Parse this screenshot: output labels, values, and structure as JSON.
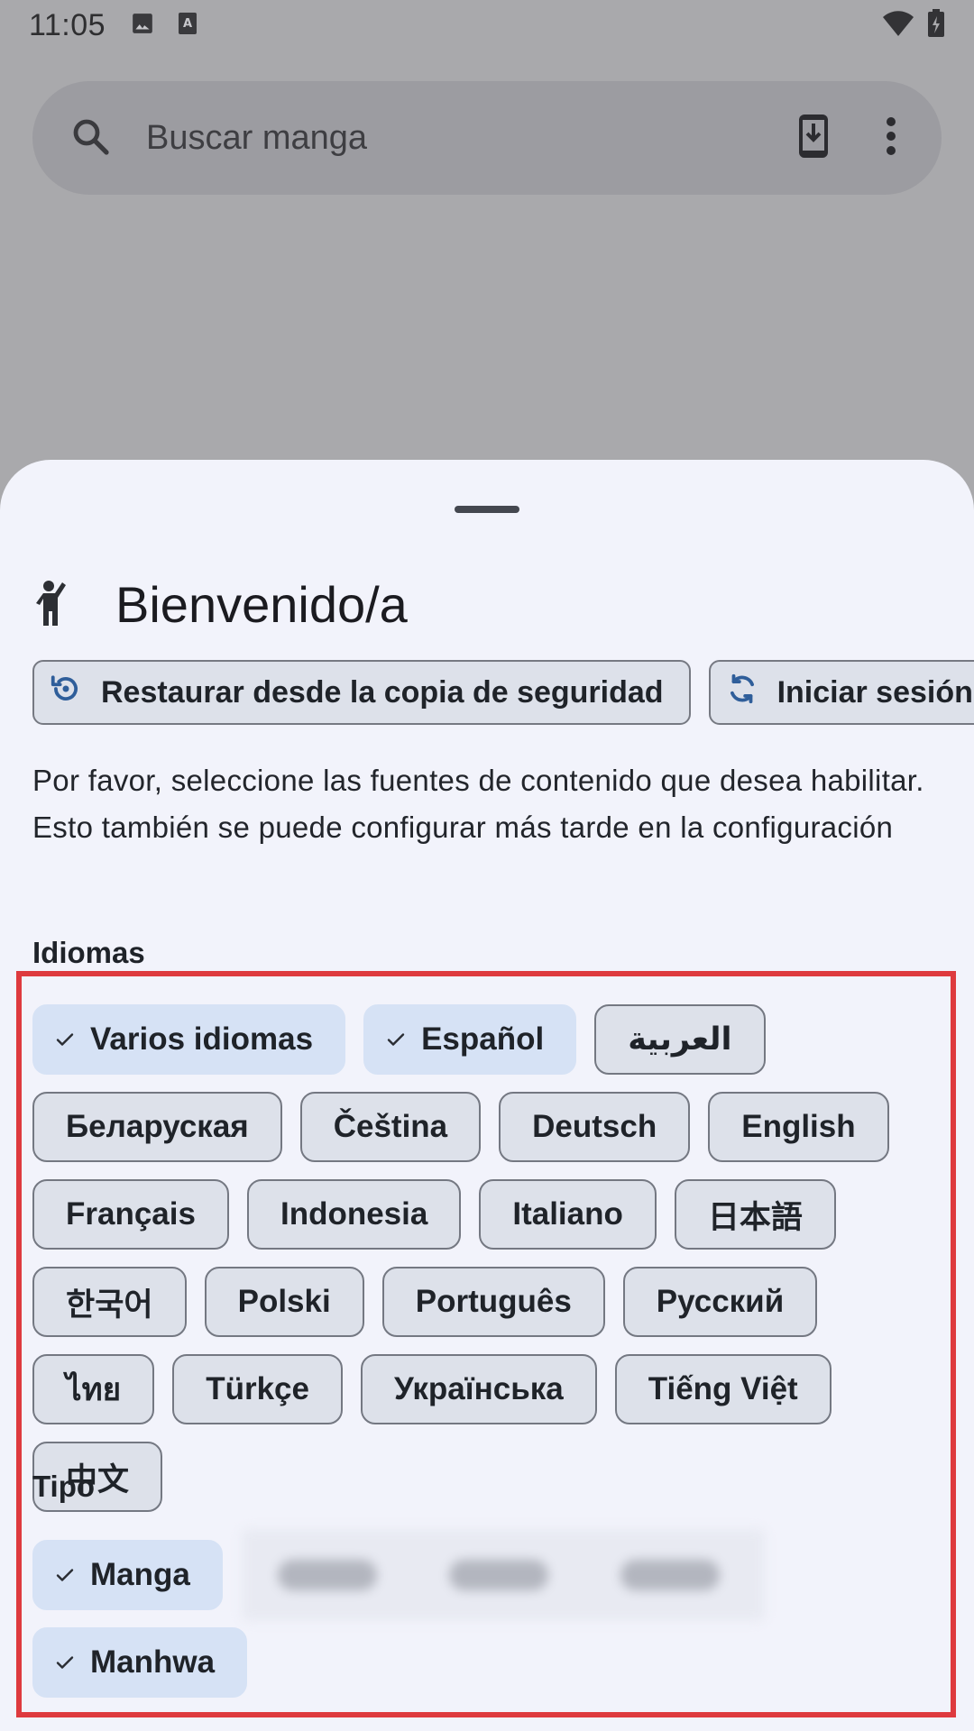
{
  "status_bar": {
    "time": "11:05",
    "left_icons": [
      "image-icon",
      "text-recognition-icon"
    ],
    "right_icons": [
      "wifi-icon",
      "battery-icon"
    ]
  },
  "search": {
    "placeholder": "Buscar manga",
    "actions": [
      "install-to-device-icon",
      "more-vert-icon"
    ]
  },
  "sheet": {
    "header_icon": "person-waving-icon",
    "title": "Bienvenido/a",
    "actions": [
      {
        "label": "Restaurar desde la copia de seguridad",
        "icon": "restore-icon"
      },
      {
        "label": "Iniciar sesión",
        "icon": "sync-icon"
      }
    ],
    "description": "Por favor, seleccione las fuentes de contenido que desea habilitar. Esto también se puede configurar más tarde en la configuración",
    "languages_label": "Idiomas",
    "languages": [
      {
        "label": "Varios idiomas",
        "selected": true
      },
      {
        "label": "Español",
        "selected": true
      },
      {
        "label": "العربية",
        "selected": false
      },
      {
        "label": "Беларуская",
        "selected": false
      },
      {
        "label": "Čeština",
        "selected": false
      },
      {
        "label": "Deutsch",
        "selected": false
      },
      {
        "label": "English",
        "selected": false
      },
      {
        "label": "Français",
        "selected": false
      },
      {
        "label": "Indonesia",
        "selected": false
      },
      {
        "label": "Italiano",
        "selected": false
      },
      {
        "label": "日本語",
        "selected": false
      },
      {
        "label": "한국어",
        "selected": false
      },
      {
        "label": "Polski",
        "selected": false
      },
      {
        "label": "Português",
        "selected": false
      },
      {
        "label": "Русский",
        "selected": false
      },
      {
        "label": "ไทย",
        "selected": false
      },
      {
        "label": "Türkçe",
        "selected": false
      },
      {
        "label": "Українська",
        "selected": false
      },
      {
        "label": "Tiếng Việt",
        "selected": false
      },
      {
        "label": "中文",
        "selected": false
      }
    ],
    "type_label": "Tipo",
    "types": [
      {
        "label": "Manga",
        "selected": true
      },
      {
        "label": "Manhwa",
        "selected": true
      }
    ]
  },
  "colors": {
    "scrim": "#a9a9ac",
    "sheet_bg": "#f2f3fb",
    "chip_selected": "#d6e2f5",
    "chip_unselected": "#dde1ea",
    "highlight": "#de3a3e",
    "icon_accent": "#2f5e9a"
  }
}
